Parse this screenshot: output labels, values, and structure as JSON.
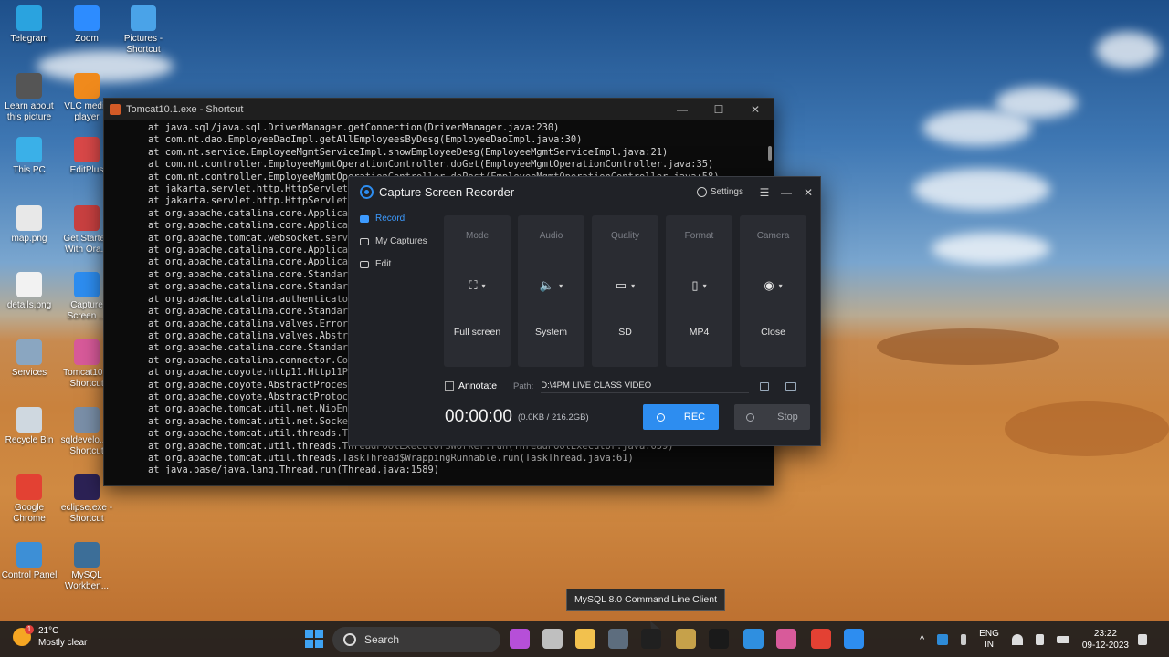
{
  "desktop_icons": [
    {
      "label": "Telegram",
      "icon": "telegram-icon",
      "color": "#2aa3df"
    },
    {
      "label": "Zoom",
      "icon": "zoom-icon",
      "color": "#2d8cff"
    },
    {
      "label": "Pictures - Shortcut",
      "icon": "pictures-folder-icon",
      "color": "#4aa3e8"
    },
    {
      "label": "Learn about this picture",
      "icon": "learn-icon",
      "color": "#555555"
    },
    {
      "label": "VLC media player",
      "icon": "vlc-icon",
      "color": "#f08a1c"
    },
    {
      "label": "This PC",
      "icon": "monitor-icon",
      "color": "#3ab0e8"
    },
    {
      "label": "EditPlus",
      "icon": "editplus-icon",
      "color": "#d94848"
    },
    {
      "label": "map.png",
      "icon": "image-file-icon",
      "color": "#e8e8e8"
    },
    {
      "label": "Get Started With Ora...",
      "icon": "database-icon",
      "color": "#c94040"
    },
    {
      "label": "details.png",
      "icon": "image-file-icon",
      "color": "#f2f2f2"
    },
    {
      "label": "Capture Screen ...",
      "icon": "capture-icon",
      "color": "#2d8df0"
    },
    {
      "label": "Services",
      "icon": "services-gear-icon",
      "color": "#8aa6c1"
    },
    {
      "label": "Tomcat10... Shortcut",
      "icon": "tomcat-icon",
      "color": "#d85a9a"
    },
    {
      "label": "Recycle Bin",
      "icon": "recycle-bin-icon",
      "color": "#cfd8e0"
    },
    {
      "label": "sqldevelo... - Shortcut",
      "icon": "sqldeveloper-icon",
      "color": "#7a8fa8"
    },
    {
      "label": "Google Chrome",
      "icon": "chrome-icon",
      "color": "#e34133"
    },
    {
      "label": "eclipse.exe - Shortcut",
      "icon": "eclipse-icon",
      "color": "#2c2255"
    },
    {
      "label": "Control Panel",
      "icon": "control-panel-icon",
      "color": "#3d8fd6"
    },
    {
      "label": "MySQL Workben...",
      "icon": "mysql-workbench-icon",
      "color": "#3c6e98"
    }
  ],
  "console": {
    "title": "Tomcat10.1.exe - Shortcut",
    "controls": [
      "—",
      "☐",
      "✕"
    ],
    "lines": [
      "at java.sql/java.sql.DriverManager.getConnection(DriverManager.java:230)",
      "at com.nt.dao.EmployeeDaoImpl.getAllEmployeesByDesg(EmployeeDaoImpl.java:30)",
      "at com.nt.service.EmployeeMgmtServiceImpl.showEmployeeDesg(EmployeeMgmtServiceImpl.java:21)",
      "at com.nt.controller.EmployeeMgmtOperationController.doGet(EmployeeMgmtOperationController.java:35)",
      "at com.nt.controller.EmployeeMgmtOperationController.doPost(EmployeeMgmtOperationController.java:58)",
      "at jakarta.servlet.http.HttpServlet.s",
      "at jakarta.servlet.http.HttpServlet.s",
      "at org.apache.catalina.core.Applicati",
      "at org.apache.catalina.core.Applicati",
      "at org.apache.tomcat.websocket.server",
      "at org.apache.catalina.core.Applicati",
      "at org.apache.catalina.core.Applicati",
      "at org.apache.catalina.core.StandardW",
      "at org.apache.catalina.core.StandardC",
      "at org.apache.catalina.authenticator.",
      "at org.apache.catalina.core.StandardH",
      "at org.apache.catalina.valves.ErrorRe",
      "at org.apache.catalina.valves.Abstrac",
      "at org.apache.catalina.core.StandardE",
      "at org.apache.catalina.connector.Coyo",
      "at org.apache.coyote.http11.Http11Pro",
      "at org.apache.coyote.AbstractProcesso",
      "at org.apache.coyote.AbstractProtocol",
      "at org.apache.tomcat.util.net.NioEndp",
      "at org.apache.tomcat.util.net.SocketP",
      "at org.apache.tomcat.util.threads.Thr",
      "at org.apache.tomcat.util.threads.ThreadPoolExecutor$Worker.run(ThreadPoolExecutor.java:659)",
      "at org.apache.tomcat.util.threads.TaskThread$WrappingRunnable.run(TaskThread.java:61)",
      "at java.base/java.lang.Thread.run(Thread.java:1589)"
    ]
  },
  "recorder": {
    "title": "Capture Screen Recorder",
    "settings_label": "Settings",
    "sidebar": [
      {
        "label": "Record",
        "active": true,
        "icon": "record-icon"
      },
      {
        "label": "My Captures",
        "active": false,
        "icon": "captures-icon"
      },
      {
        "label": "Edit",
        "active": false,
        "icon": "edit-icon"
      }
    ],
    "tiles": [
      {
        "label": "Mode",
        "value": "Full screen",
        "icon": "fullscreen-icon",
        "glyph": "⛶"
      },
      {
        "label": "Audio",
        "value": "System",
        "icon": "speaker-icon",
        "glyph": "🔈"
      },
      {
        "label": "Quality",
        "value": "SD",
        "icon": "laptop-icon",
        "glyph": "▭"
      },
      {
        "label": "Format",
        "value": "MP4",
        "icon": "file-icon",
        "glyph": "▯"
      },
      {
        "label": "Camera",
        "value": "Close",
        "icon": "camera-icon",
        "glyph": "◉"
      }
    ],
    "annotate_label": "Annotate",
    "path_label": "Path:",
    "path_value": "D:\\4PM LIVE CLASS VIDEO",
    "timer": "00:00:00",
    "size_info": "(0.0KB / 216.2GB)",
    "rec_label": "REC",
    "stop_label": "Stop",
    "accent": "#2d8df0"
  },
  "tooltip": "MySQL 8.0 Command Line Client",
  "taskbar": {
    "weather_temp": "21°C",
    "weather_desc": "Mostly clear",
    "weather_badge": "1",
    "search_label": "Search",
    "apps": [
      {
        "icon": "copilot-icon",
        "color": "#b64fd8"
      },
      {
        "icon": "task-view-icon",
        "color": "#bfbfbf"
      },
      {
        "icon": "file-explorer-icon",
        "color": "#f2c14e"
      },
      {
        "icon": "terminal-window-icon",
        "color": "#5d6d7e"
      },
      {
        "icon": "mysql-cli-icon",
        "color": "#202020"
      },
      {
        "icon": "git-icon",
        "color": "#c6a14a"
      },
      {
        "icon": "cmd-icon",
        "color": "#1a1a1a"
      },
      {
        "icon": "vscode-icon",
        "color": "#2f8fe0"
      },
      {
        "icon": "tomcat-taskbar-icon",
        "color": "#d85a9a"
      },
      {
        "icon": "chrome-taskbar-icon",
        "color": "#e34133"
      },
      {
        "icon": "capture-taskbar-icon",
        "color": "#2d8df0"
      }
    ],
    "lang_line1": "ENG",
    "lang_line2": "IN",
    "time": "23:22",
    "date": "09-12-2023"
  }
}
